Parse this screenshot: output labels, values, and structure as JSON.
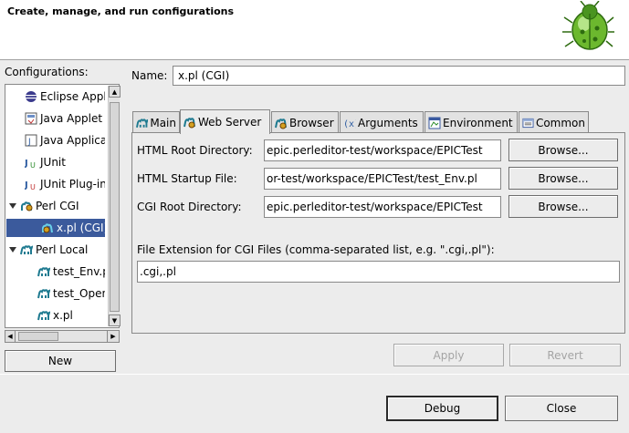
{
  "header": {
    "title": "Create, manage, and run configurations",
    "logo_icon": "epic-bug-icon"
  },
  "left": {
    "configurations_label": "Configurations:",
    "tree": [
      {
        "label": "Eclipse Application",
        "icon": "eclipse-icon",
        "depth": 1
      },
      {
        "label": "Java Applet",
        "icon": "java-applet-icon",
        "depth": 1
      },
      {
        "label": "Java Application",
        "icon": "java-app-icon",
        "depth": 1
      },
      {
        "label": "JUnit",
        "icon": "junit-icon",
        "depth": 1
      },
      {
        "label": "JUnit Plug-in Test",
        "icon": "junit-plugin-icon",
        "depth": 1
      },
      {
        "label": "Perl CGI",
        "icon": "perl-cgi-icon",
        "depth": 0,
        "expanded": true
      },
      {
        "label": "x.pl (CGI)",
        "icon": "perl-cgi-config-icon",
        "depth": 2,
        "selected": true
      },
      {
        "label": "Perl Local",
        "icon": "camel-icon",
        "depth": 0,
        "expanded": true
      },
      {
        "label": "test_Env.pl",
        "icon": "camel-icon",
        "depth": 1
      },
      {
        "label": "test_Open.pl",
        "icon": "camel-icon",
        "depth": 1
      },
      {
        "label": "x.pl",
        "icon": "camel-icon",
        "depth": 1
      }
    ],
    "new_button": "New"
  },
  "main": {
    "name_label": "Name:",
    "name_value": "x.pl (CGI)",
    "tabs": [
      {
        "label": "Main",
        "icon": "camel-icon"
      },
      {
        "label": "Web Server",
        "icon": "web-server-icon",
        "active": true
      },
      {
        "label": "Browser",
        "icon": "browser-icon"
      },
      {
        "label": "Arguments",
        "icon": "arguments-icon"
      },
      {
        "label": "Environment",
        "icon": "environment-icon"
      },
      {
        "label": "Common",
        "icon": "common-icon"
      }
    ],
    "fields": {
      "html_root_label": "HTML Root Directory:",
      "html_root_value": "epic.perleditor-test/workspace/EPICTest",
      "html_startup_label": "HTML Startup File:",
      "html_startup_value": "or-test/workspace/EPICTest/test_Env.pl",
      "cgi_root_label": "CGI Root Directory:",
      "cgi_root_value": "epic.perleditor-test/workspace/EPICTest",
      "browse_label": "Browse...",
      "ext_label": "File Extension for CGI Files (comma-separated list, e.g. \".cgi,.pl\"):",
      "ext_value": ".cgi,.pl"
    },
    "apply_button": "Apply",
    "revert_button": "Revert"
  },
  "footer": {
    "debug_button": "Debug",
    "close_button": "Close"
  }
}
